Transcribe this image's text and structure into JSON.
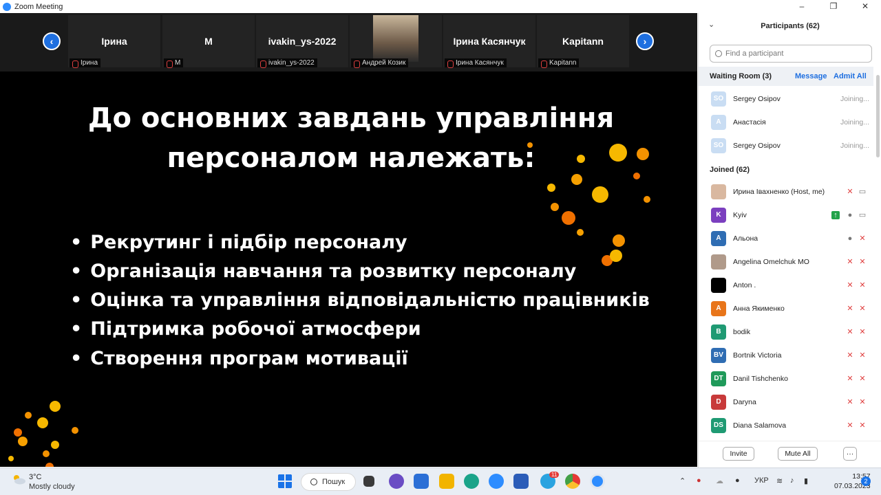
{
  "window": {
    "title": "Zoom Meeting",
    "controls": [
      "–",
      "❐",
      "✕"
    ]
  },
  "strip": {
    "tiles": [
      {
        "name": "Ірина",
        "label": "Ірина"
      },
      {
        "name": "M",
        "label": "M"
      },
      {
        "name": "ivakin_ys-2022",
        "label": "ivakin_ys-2022"
      },
      {
        "name": "",
        "label": "Андрей Козик"
      },
      {
        "name": "Ірина Касянчук",
        "label": "Ірина Касянчук"
      },
      {
        "name": "Kapitann",
        "label": "Kapitann"
      }
    ],
    "prev": "‹",
    "next": "›"
  },
  "slide": {
    "title": "До основних завдань управління персоналом належать:",
    "bullets": [
      "Рекрутинг і підбір персоналу",
      "Організація навчання та розвитку персоналу",
      "Оцінка та управління відповідальністю працівників",
      "Підтримка робочої атмосфери",
      "Створення програм мотивації"
    ]
  },
  "panel": {
    "title": "Participants (62)",
    "search_placeholder": "Find a participant",
    "waiting_room": {
      "label": "Waiting Room (3)",
      "message": "Message",
      "admit_all": "Admit All"
    },
    "waiting": [
      {
        "initials": "SO",
        "name": "Sergey Osipov",
        "status": "Joining..."
      },
      {
        "initials": "A",
        "name": "Анастасія",
        "status": "Joining..."
      },
      {
        "initials": "SO",
        "name": "Sergey Osipov",
        "status": "Joining..."
      }
    ],
    "joined_label": "Joined (62)",
    "joined": [
      {
        "initials": "",
        "name": "Ирина Іваxненко (Host, me)",
        "color": "#d9b8a0"
      },
      {
        "initials": "K",
        "name": "Kyiv",
        "color": "#7b3fbf"
      },
      {
        "initials": "A",
        "name": "Альона",
        "color": "#2f6db3"
      },
      {
        "initials": "",
        "name": "Angelina Omelchuk MO",
        "color": "#b09a8a"
      },
      {
        "initials": "",
        "name": "Anton .",
        "color": "#000000"
      },
      {
        "initials": "A",
        "name": "Анна Якименко",
        "color": "#e8751a"
      },
      {
        "initials": "B",
        "name": "bodik",
        "color": "#1f9a73"
      },
      {
        "initials": "BV",
        "name": "Bortnik Victoria",
        "color": "#2f6db3"
      },
      {
        "initials": "DT",
        "name": "Danil Tishchenko",
        "color": "#1f9a5a"
      },
      {
        "initials": "D",
        "name": "Daryna",
        "color": "#c83a3a"
      },
      {
        "initials": "DS",
        "name": "Diana Salamova",
        "color": "#1f9a73"
      }
    ],
    "footer": {
      "invite": "Invite",
      "mute_all": "Mute All",
      "more": "···"
    }
  },
  "taskbar": {
    "weather_temp": "3°C",
    "weather_cond": "Mostly cloudy",
    "search": "Пошук",
    "lang": "УКР",
    "time": "13:57",
    "date": "07.03.2023",
    "badge": "2",
    "telegram_badge": "11"
  }
}
